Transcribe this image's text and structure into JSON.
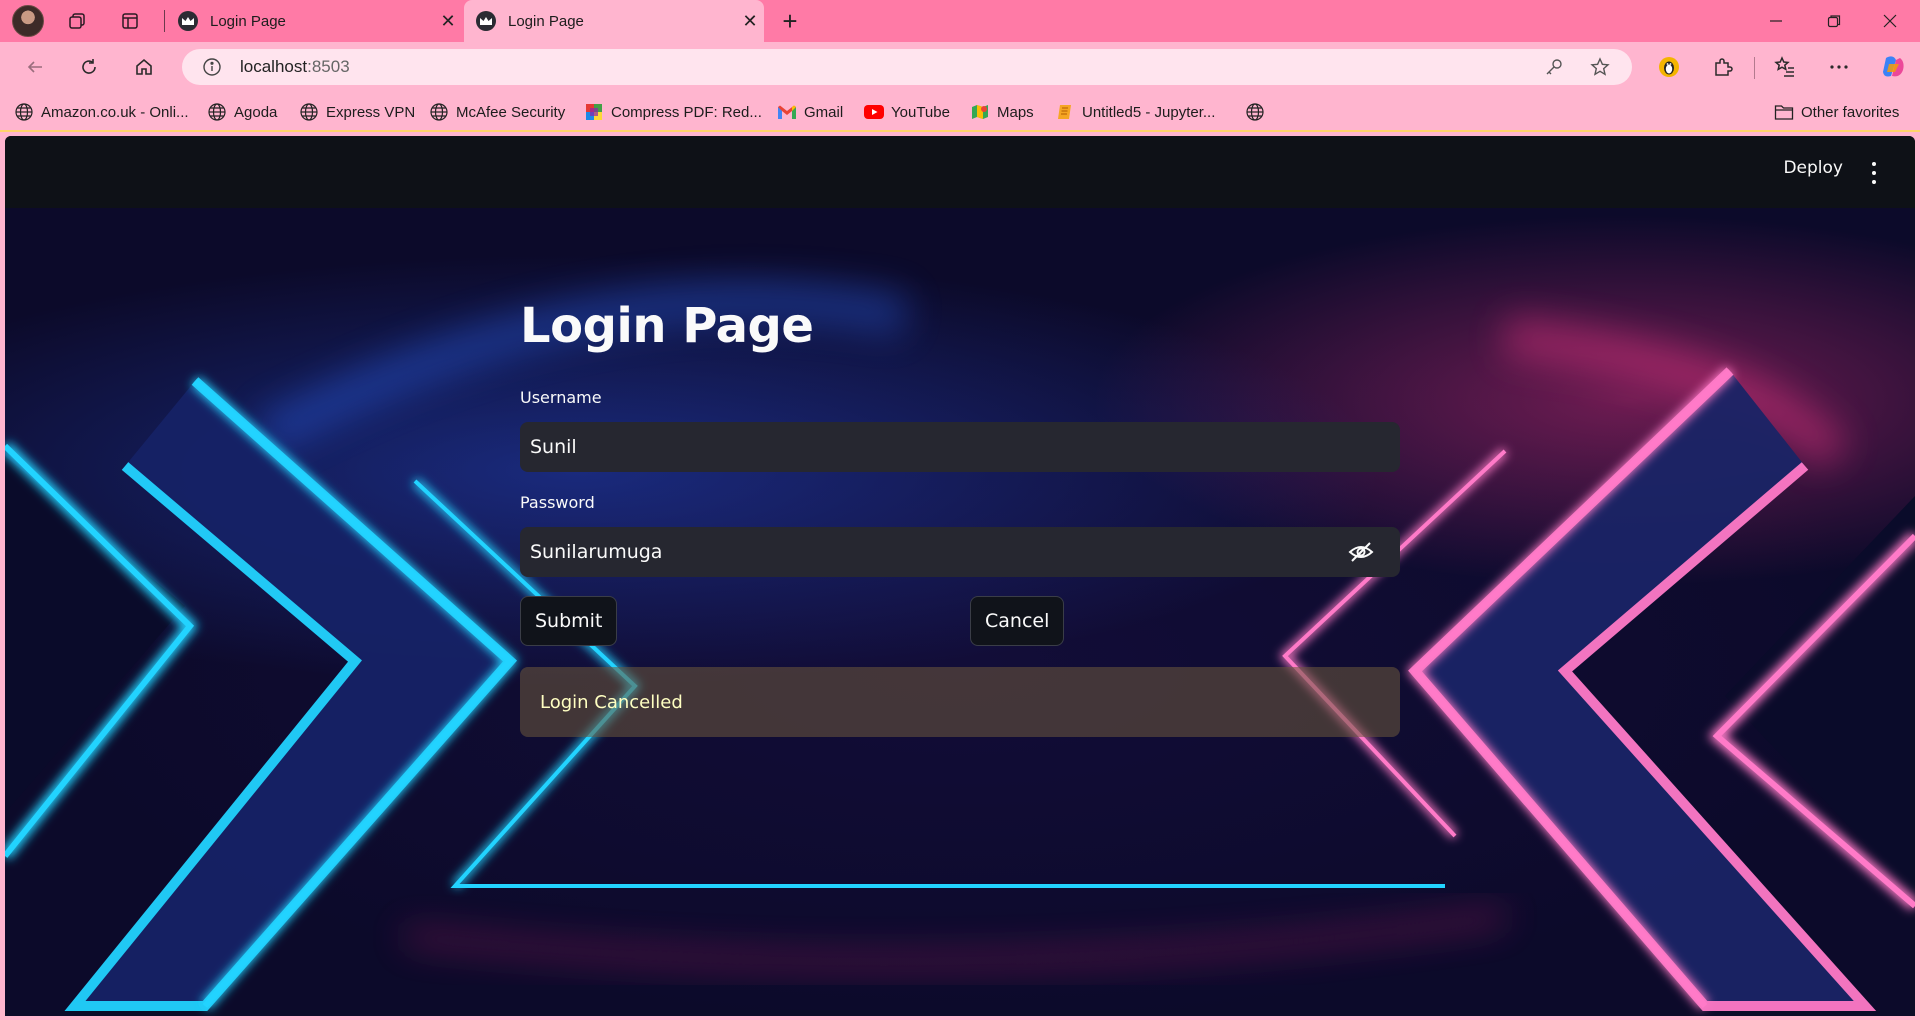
{
  "browser": {
    "tabs": [
      {
        "title": "Login Page",
        "active": false
      },
      {
        "title": "Login Page",
        "active": true
      }
    ],
    "new_tab_label": "+",
    "address": {
      "host": "localhost",
      "port": ":8503"
    },
    "bookmarks": [
      {
        "label": "Amazon.co.uk - Onli...",
        "icon": "globe-icon"
      },
      {
        "label": "Agoda",
        "icon": "globe-icon"
      },
      {
        "label": "Express VPN",
        "icon": "globe-icon"
      },
      {
        "label": "McAfee Security",
        "icon": "globe-icon"
      },
      {
        "label": "Compress PDF: Red...",
        "icon": "compress-pdf-icon"
      },
      {
        "label": "Gmail",
        "icon": "gmail-icon"
      },
      {
        "label": "YouTube",
        "icon": "youtube-icon"
      },
      {
        "label": "Maps",
        "icon": "maps-icon"
      },
      {
        "label": "Untitled5 - Jupyter...",
        "icon": "jupyter-icon"
      },
      {
        "label": "",
        "icon": "globe-icon"
      }
    ],
    "other_favorites": "Other favorites",
    "colors": {
      "tabbar": "#ff7aa6",
      "toolbar": "#ffb5cf"
    }
  },
  "app": {
    "header": {
      "deploy_label": "Deploy"
    },
    "title": "Login Page",
    "username": {
      "label": "Username",
      "value": "Sunil"
    },
    "password": {
      "label": "Password",
      "value": "Sunilarumuga"
    },
    "submit_label": "Submit",
    "cancel_label": "Cancel",
    "alert": {
      "text": "Login Cancelled",
      "kind": "warning"
    },
    "colors": {
      "header_bg": "#0e1117",
      "input_bg": "#262730",
      "alert_text": "#ffffc2"
    }
  }
}
